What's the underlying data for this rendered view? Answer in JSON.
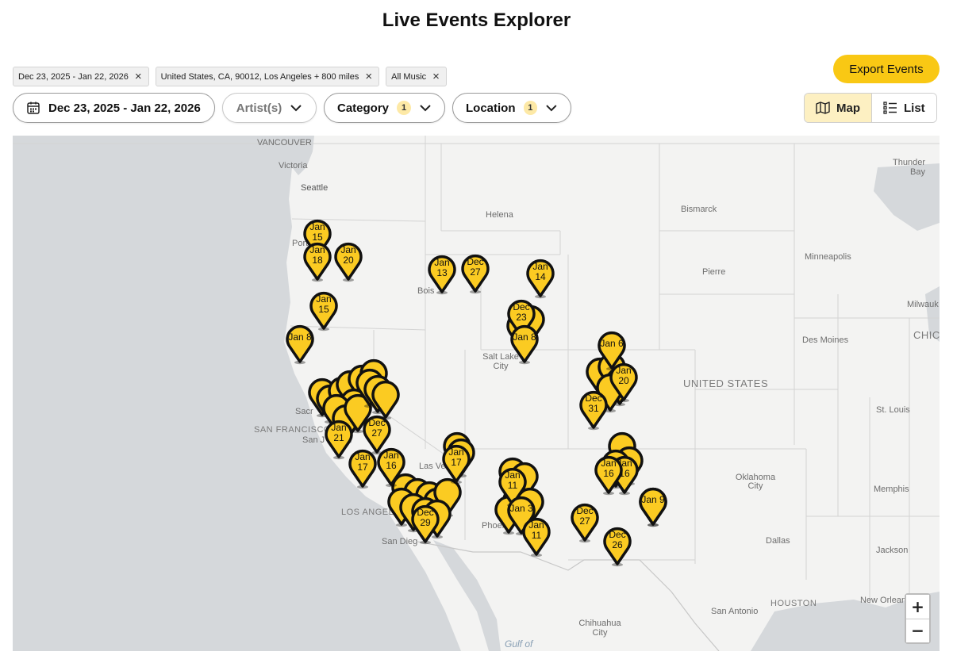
{
  "title": "Live Events Explorer",
  "chips": [
    {
      "label": "Dec 23, 2025 - Jan 22, 2026"
    },
    {
      "label": "United States, CA, 90012, Los Angeles + 800 miles"
    },
    {
      "label": "All Music"
    }
  ],
  "chip_remove_glyph": "×",
  "export_label": "Export Events",
  "filters": {
    "date": "Dec 23, 2025 - Jan 22, 2026",
    "artist": "Artist(s)",
    "category": "Category",
    "category_count": "1",
    "location": "Location",
    "location_count": "1"
  },
  "view": {
    "map": "Map",
    "list": "List",
    "active": "map"
  },
  "map": {
    "labels": {
      "vancouver": "VANCOUVER",
      "victoria": "Victoria",
      "seattle": "Seattle",
      "portland": "Port",
      "helena": "Helena",
      "bismarck": "Bismarck",
      "pierre": "Pierre",
      "minneapolis": "Minneapolis",
      "thunder_bay": "Thunder Bay",
      "milwaukee": "Milwauk",
      "chicago": "CHICA",
      "des_moines": "Des Moines",
      "boise": "Bois",
      "salt_lake": "Salt Lake City",
      "united_states": "UNITED STATES",
      "st_louis": "St. Louis",
      "sacramento": "Sacr",
      "san_francisco": "SAN FRANCISCO",
      "san_jose": "San J",
      "las_vegas": "Las Ve",
      "los_angeles": "LOS ANGELE",
      "san_diego": "San Dieg",
      "phoenix": "Phoen",
      "oklahoma_city": "Oklahoma City",
      "memphis": "Memphis",
      "dallas": "Dallas",
      "jackson": "Jackson",
      "houston": "HOUSTON",
      "san_antonio": "San Antonio",
      "new_orleans": "New Orlean",
      "chihuahua": "Chihuahua City",
      "gulf": "Gulf of"
    },
    "zoom_in": "+",
    "zoom_out": "−"
  },
  "pins": [
    {
      "l1": "Jan",
      "l2": "15"
    },
    {
      "l1": "Jan",
      "l2": "18"
    },
    {
      "l1": "Jan",
      "l2": "20"
    },
    {
      "l1": "Jan",
      "l2": "15"
    },
    {
      "l1": "Jan 8",
      "l2": ""
    },
    {
      "l1": "Jan",
      "l2": "13"
    },
    {
      "l1": "Dec",
      "l2": "27"
    },
    {
      "l1": "Jan",
      "l2": "14"
    },
    {
      "l1": "Dec",
      "l2": "23"
    },
    {
      "l1": "Jan 8",
      "l2": ""
    },
    {
      "l1": "Jan 6",
      "l2": ""
    },
    {
      "l1": "Jan",
      "l2": "20"
    },
    {
      "l1": "Dec",
      "l2": "31"
    },
    {
      "l1": "Jan",
      "l2": "16"
    },
    {
      "l1": "Jan 9",
      "l2": ""
    },
    {
      "l1": "Dec",
      "l2": "27"
    },
    {
      "l1": "Jan",
      "l2": "21"
    },
    {
      "l1": "Jan",
      "l2": "17"
    },
    {
      "l1": "Jan",
      "l2": "16"
    },
    {
      "l1": "Jan",
      "l2": "17"
    },
    {
      "l1": "Dec",
      "l2": "29"
    },
    {
      "l1": "Jan",
      "l2": "11"
    },
    {
      "l1": "Jan 3",
      "l2": ""
    },
    {
      "l1": "Jan",
      "l2": "11"
    },
    {
      "l1": "Dec",
      "l2": "27"
    },
    {
      "l1": "Jan",
      "l2": "16"
    },
    {
      "l1": "Jan 9",
      "l2": ""
    },
    {
      "l1": "Dec",
      "l2": "26"
    }
  ],
  "colors": {
    "accent": "#f9c814",
    "pin_fill": "#fbcb22",
    "pin_stroke": "#111111",
    "land": "#f3f3f2",
    "water": "#d5d8db"
  }
}
